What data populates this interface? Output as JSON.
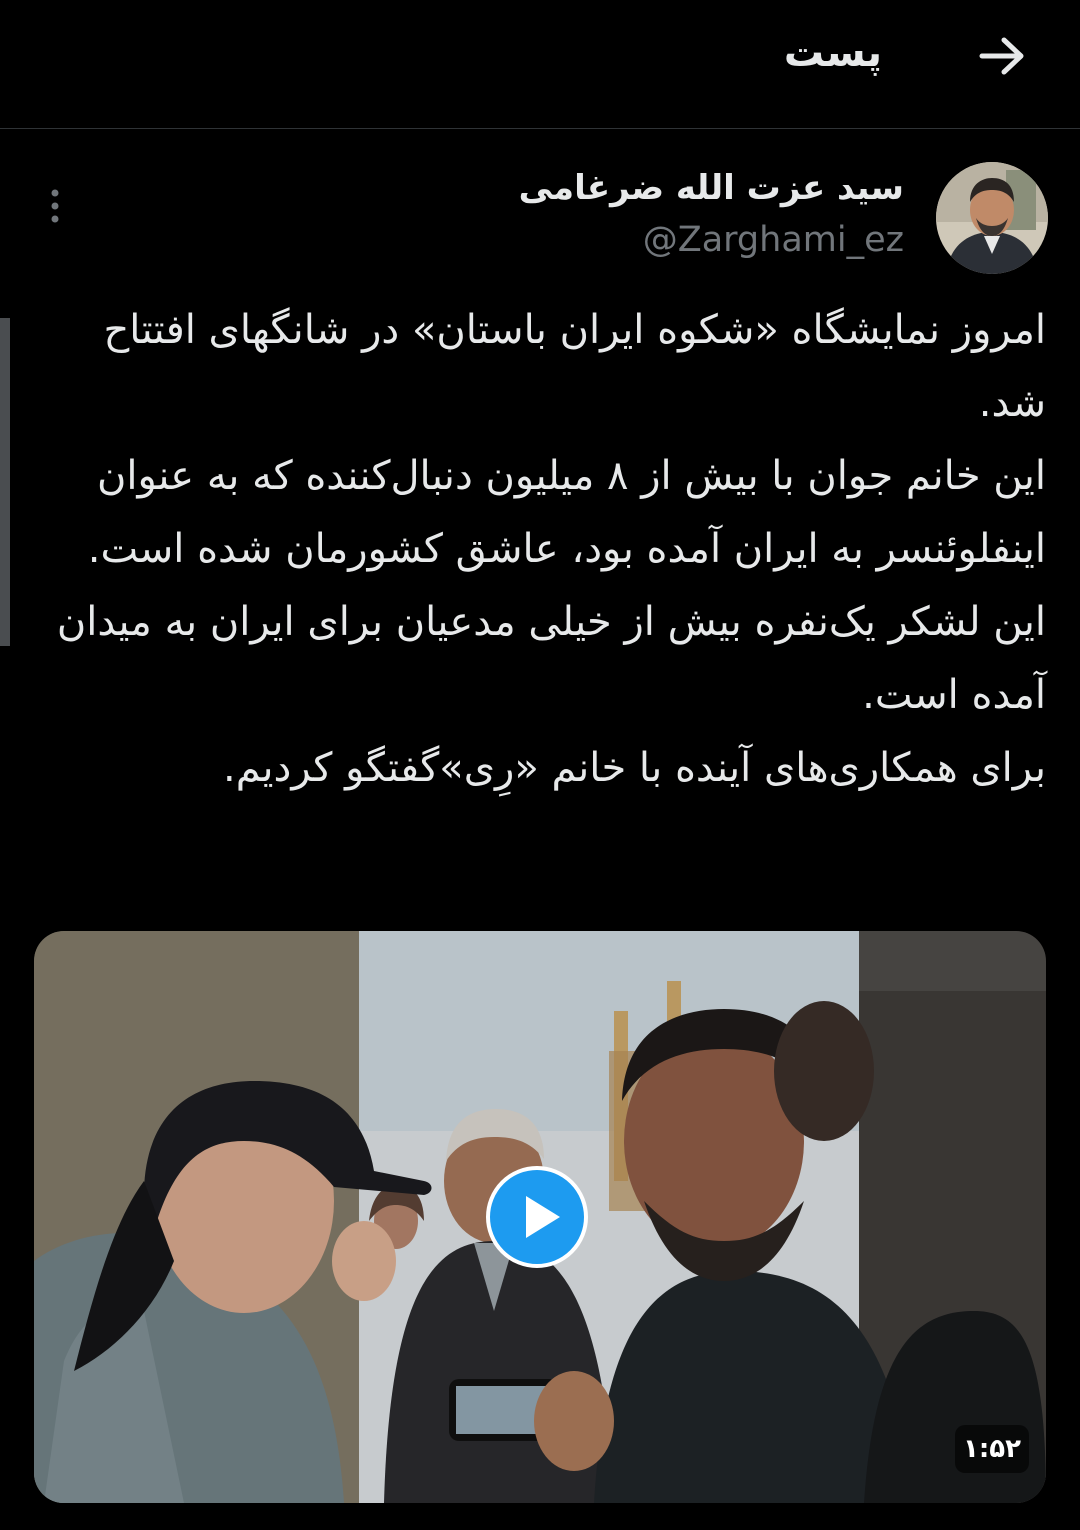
{
  "header": {
    "title": "پست",
    "back_icon": "arrow-right-icon"
  },
  "tweet": {
    "author": {
      "display_name": "سید عزت الله ضرغامی",
      "handle": "@Zarghami_ez",
      "avatar_icon": "profile-photo"
    },
    "more_icon": "more-vertical-icon",
    "paragraphs": [
      "امروز نمایشگاه «شکوه ایران باستان» در شانگهای افتتاح شد.",
      "این خانم جوان با بیش از ۸ میلیون دنبال‌کننده که به عنوان اینفلوئنسر به ایران آمده بود، عاشق کشورمان شده است.",
      "این لشکر یک‌نفره بیش از خیلی مدعیان برای ایران به میدان آمده است.",
      "برای همکاری‌های آینده با خانم «رِی»گفتگو کردیم."
    ],
    "media": {
      "type": "video",
      "duration": "۱:۵۲",
      "play_icon": "play-icon"
    }
  },
  "colors": {
    "background": "#000000",
    "text": "#e7e9ea",
    "secondary_text": "#71767b",
    "accent": "#1d9bf0",
    "divider": "#2f3336"
  }
}
